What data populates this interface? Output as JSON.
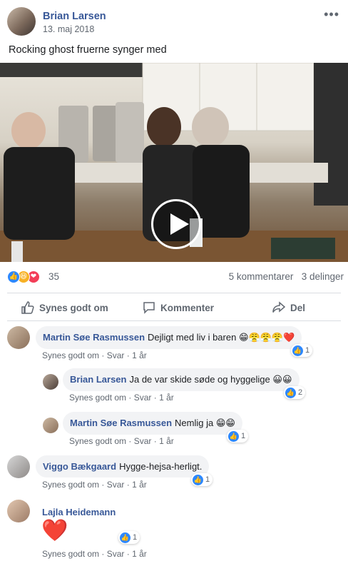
{
  "post": {
    "author": "Brian Larsen",
    "date": "13. maj 2018",
    "more_icon": "•••",
    "text": "Rocking ghost fruerne synger med"
  },
  "stats": {
    "reaction_count": "35",
    "comments": "5 kommentarer",
    "shares": "3 delinger",
    "reaction_icons": [
      "like",
      "haha",
      "love"
    ]
  },
  "actions": {
    "like": "Synes godt om",
    "comment": "Kommenter",
    "share": "Del"
  },
  "comments": [
    {
      "name": "Martin Søe Rasmussen",
      "text": "Dejligt med liv i baren",
      "emoji": "😁😤😤😤❤️",
      "like": "Synes godt om",
      "reply": "Svar",
      "time": "1 år",
      "likes": "1"
    },
    {
      "name": "Brian Larsen",
      "text": "Ja de var skide søde og hyggelige",
      "emoji": "😀😀",
      "like": "Synes godt om",
      "reply": "Svar",
      "time": "1 år",
      "likes": "2"
    },
    {
      "name": "Martin Søe Rasmussen",
      "text": "Nemlig ja",
      "emoji": "😁😁",
      "like": "Synes godt om",
      "reply": "Svar",
      "time": "1 år",
      "likes": "1"
    },
    {
      "name": "Viggo Bækgaard",
      "text": "Hygge-hejsa-herligt.",
      "like": "Synes godt om",
      "reply": "Svar",
      "time": "1 år",
      "likes": "1"
    },
    {
      "name": "Lajla Heidemann",
      "emoji": "❤️",
      "like": "Synes godt om",
      "reply": "Svar",
      "time": "1 år",
      "likes": "1"
    }
  ],
  "separator": "·",
  "colors": {
    "link": "#385898",
    "muted": "#606770",
    "bubble": "#f2f3f5",
    "like_blue": "#2d88ff",
    "love_red": "#f33e58",
    "haha_yellow": "#f7b125"
  }
}
